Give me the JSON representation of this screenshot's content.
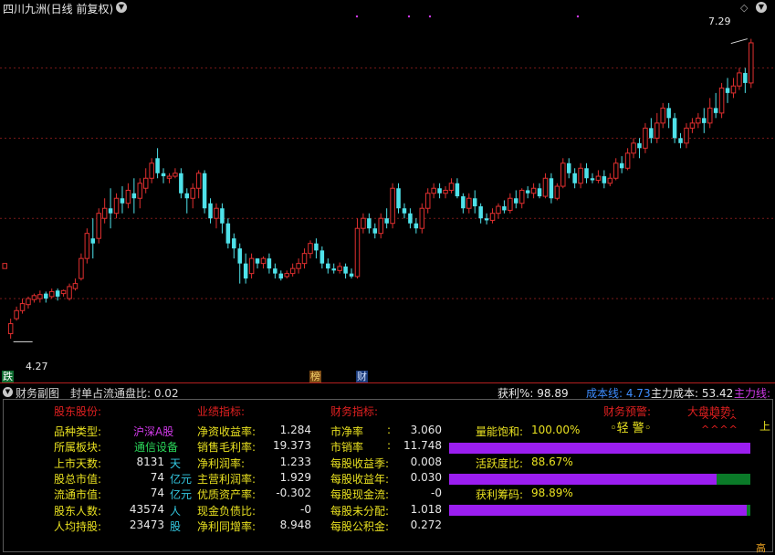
{
  "header": {
    "title": "四川九洲(日线 前复权)",
    "menu_icon": "chevron-down-icon",
    "right_icon": "diamond-icon",
    "high_label": "7.29",
    "low_label": "4.27"
  },
  "colors": {
    "up": "#e02f2f",
    "down": "#4fe2ea",
    "grid": "#7a1a1a",
    "accent_purple": "#9b1ef0",
    "bar_green": "#0a7a28"
  },
  "tags": {
    "die": "跌",
    "bang": "榜",
    "cai": "财"
  },
  "subchart": {
    "title": "财务副图",
    "seal_label": "封单占流通盘比: 0.02",
    "profit_label": "获利%: 98.89",
    "cost_line": "成本线: 4.73",
    "main_cost": "主力成本: 53.42",
    "main_line": "主力线:"
  },
  "panel": {
    "shareholder_header": "股东股份:",
    "perf_header": "业绩指标:",
    "fin_header": "财务指标:",
    "warn_header": "财务预警:",
    "trend_header": "大盘趋势:",
    "warn_value": "◦轻 警◦",
    "trend_value": "^^^^\n^^^^",
    "edge_text": "上",
    "edge_text2": "高",
    "col1": [
      {
        "label": "品种类型:",
        "value": "沪深A股",
        "unit": ""
      },
      {
        "label": "所属板块:",
        "value": "通信设备",
        "unit": ""
      },
      {
        "label": "上市天数:",
        "value": "8131",
        "unit": "天"
      },
      {
        "label": "股总市值:",
        "value": "74",
        "unit": "亿元"
      },
      {
        "label": "流通市值:",
        "value": "74",
        "unit": "亿元"
      },
      {
        "label": "股东人数:",
        "value": "43574",
        "unit": "人"
      },
      {
        "label": "人均持股:",
        "value": "23473",
        "unit": "股"
      }
    ],
    "col2": [
      {
        "label": "净资收益率:",
        "value": "1.284"
      },
      {
        "label": "销售毛利率:",
        "value": "19.373"
      },
      {
        "label": "净利润率:",
        "value": "1.233"
      },
      {
        "label": "主营利润率:",
        "value": "1.929"
      },
      {
        "label": "优质资产率:",
        "value": "-0.302"
      },
      {
        "label": "现金负债比:",
        "value": "-0"
      },
      {
        "label": "净利同增率:",
        "value": "8.948"
      }
    ],
    "col3": [
      {
        "label": "市净率",
        "sep": ":",
        "value": "3.060"
      },
      {
        "label": "市销率",
        "sep": ":",
        "value": "11.748"
      },
      {
        "label": "每股收益季:",
        "sep": "",
        "value": "0.008"
      },
      {
        "label": "每股收益年:",
        "sep": "",
        "value": "0.030"
      },
      {
        "label": "每股现金流:",
        "sep": "",
        "value": "-0"
      },
      {
        "label": "每股未分配:",
        "sep": "",
        "value": "1.018"
      },
      {
        "label": "每股公积金:",
        "sep": "",
        "value": "0.272"
      }
    ],
    "metrics": [
      {
        "label": "量能饱和:",
        "text": "100.00%",
        "value": 1.0
      },
      {
        "label": "活跃度比:",
        "text": "88.67%",
        "value": 0.8867
      },
      {
        "label": "获利筹码:",
        "text": "98.89%",
        "value": 0.9889
      }
    ]
  },
  "chart_data": {
    "type": "candlestick",
    "ylim": [
      4.0,
      7.55
    ],
    "grid_levels": [
      4.7,
      5.5,
      6.3,
      7.0
    ],
    "high_marker": 7.29,
    "low_marker": 4.27,
    "candles": [
      [
        5.0,
        5.05,
        5.05,
        5.05
      ],
      [
        4.35,
        4.45,
        4.3,
        4.5
      ],
      [
        4.5,
        4.58,
        4.48,
        4.62
      ],
      [
        4.58,
        4.65,
        4.55,
        4.7
      ],
      [
        4.64,
        4.7,
        4.6,
        4.72
      ],
      [
        4.69,
        4.73,
        4.66,
        4.75
      ],
      [
        4.7,
        4.74,
        4.66,
        4.78
      ],
      [
        4.75,
        4.7,
        4.66,
        4.77
      ],
      [
        4.72,
        4.77,
        4.7,
        4.8
      ],
      [
        4.78,
        4.72,
        4.68,
        4.8
      ],
      [
        4.75,
        4.78,
        4.72,
        4.79
      ],
      [
        4.7,
        4.82,
        4.68,
        4.85
      ],
      [
        4.8,
        4.85,
        4.78,
        4.9
      ],
      [
        4.9,
        5.1,
        4.88,
        5.15
      ],
      [
        5.1,
        5.35,
        5.05,
        5.4
      ],
      [
        5.3,
        5.25,
        5.1,
        5.5
      ],
      [
        5.3,
        5.55,
        5.25,
        5.6
      ],
      [
        5.5,
        5.6,
        5.45,
        5.7
      ],
      [
        5.6,
        5.55,
        5.4,
        5.8
      ],
      [
        5.55,
        5.7,
        5.5,
        5.75
      ],
      [
        5.7,
        5.65,
        5.55,
        5.82
      ],
      [
        5.65,
        5.78,
        5.6,
        5.85
      ],
      [
        5.75,
        5.7,
        5.55,
        5.9
      ],
      [
        5.7,
        5.85,
        5.6,
        5.9
      ],
      [
        5.8,
        5.9,
        5.75,
        6.0
      ],
      [
        5.9,
        6.05,
        5.85,
        6.1
      ],
      [
        6.1,
        5.95,
        5.9,
        6.2
      ],
      [
        5.95,
        5.92,
        5.85,
        6.0
      ],
      [
        5.9,
        5.92,
        5.85,
        5.95
      ],
      [
        5.92,
        5.95,
        5.9,
        6.0
      ],
      [
        5.95,
        5.75,
        5.7,
        6.0
      ],
      [
        5.75,
        5.7,
        5.55,
        5.8
      ],
      [
        5.7,
        5.8,
        5.6,
        5.85
      ],
      [
        5.8,
        5.95,
        5.7,
        5.98
      ],
      [
        5.95,
        5.6,
        5.55,
        5.98
      ],
      [
        5.65,
        5.5,
        5.45,
        5.7
      ],
      [
        5.5,
        5.6,
        5.4,
        5.65
      ],
      [
        5.6,
        5.45,
        5.35,
        5.65
      ],
      [
        5.45,
        5.25,
        5.2,
        5.5
      ],
      [
        5.3,
        5.2,
        5.1,
        5.35
      ],
      [
        5.2,
        5.05,
        4.85,
        5.25
      ],
      [
        5.05,
        4.9,
        4.85,
        5.15
      ],
      [
        4.95,
        5.1,
        4.9,
        5.15
      ],
      [
        5.1,
        5.05,
        5.0,
        5.1
      ],
      [
        5.05,
        5.1,
        5.0,
        5.12
      ],
      [
        5.1,
        5.0,
        4.95,
        5.15
      ],
      [
        5.0,
        4.95,
        4.9,
        5.05
      ],
      [
        4.95,
        4.9,
        4.88,
        4.98
      ],
      [
        4.92,
        4.95,
        4.9,
        4.98
      ],
      [
        4.95,
        5.0,
        4.92,
        5.05
      ],
      [
        5.0,
        5.05,
        4.95,
        5.1
      ],
      [
        5.05,
        5.15,
        5.0,
        5.2
      ],
      [
        5.15,
        5.25,
        5.1,
        5.28
      ],
      [
        5.25,
        5.18,
        5.1,
        5.3
      ],
      [
        5.18,
        5.05,
        5.0,
        5.22
      ],
      [
        5.05,
        5.0,
        4.95,
        5.1
      ],
      [
        5.0,
        4.98,
        4.95,
        5.05
      ],
      [
        4.98,
        5.02,
        4.95,
        5.06
      ],
      [
        5.02,
        4.95,
        4.9,
        5.05
      ],
      [
        4.95,
        4.92,
        4.9,
        5.0
      ],
      [
        4.92,
        5.4,
        4.9,
        5.5
      ],
      [
        5.4,
        5.5,
        5.35,
        5.55
      ],
      [
        5.5,
        5.4,
        5.35,
        5.55
      ],
      [
        5.4,
        5.35,
        5.3,
        5.45
      ],
      [
        5.35,
        5.5,
        5.3,
        5.55
      ],
      [
        5.5,
        5.45,
        5.4,
        5.6
      ],
      [
        5.45,
        5.8,
        5.4,
        5.85
      ],
      [
        5.8,
        5.6,
        5.55,
        5.85
      ],
      [
        5.6,
        5.55,
        5.5,
        5.65
      ],
      [
        5.55,
        5.45,
        5.4,
        5.6
      ],
      [
        5.45,
        5.4,
        5.35,
        5.5
      ],
      [
        5.4,
        5.6,
        5.35,
        5.65
      ],
      [
        5.6,
        5.75,
        5.55,
        5.8
      ],
      [
        5.75,
        5.8,
        5.7,
        5.85
      ],
      [
        5.8,
        5.75,
        5.7,
        5.85
      ],
      [
        5.75,
        5.78,
        5.7,
        5.82
      ],
      [
        5.78,
        5.85,
        5.75,
        5.9
      ],
      [
        5.85,
        5.72,
        5.7,
        5.9
      ],
      [
        5.72,
        5.6,
        5.55,
        5.75
      ],
      [
        5.6,
        5.7,
        5.55,
        5.75
      ],
      [
        5.7,
        5.62,
        5.55,
        5.78
      ],
      [
        5.62,
        5.5,
        5.45,
        5.65
      ],
      [
        5.5,
        5.48,
        5.44,
        5.55
      ],
      [
        5.48,
        5.55,
        5.45,
        5.6
      ],
      [
        5.55,
        5.62,
        5.5,
        5.65
      ],
      [
        5.62,
        5.58,
        5.55,
        5.68
      ],
      [
        5.58,
        5.7,
        5.55,
        5.75
      ],
      [
        5.7,
        5.65,
        5.6,
        5.78
      ],
      [
        5.65,
        5.78,
        5.6,
        5.8
      ],
      [
        5.78,
        5.75,
        5.7,
        5.82
      ],
      [
        5.75,
        5.8,
        5.7,
        5.85
      ],
      [
        5.8,
        5.72,
        5.7,
        5.85
      ],
      [
        5.72,
        5.9,
        5.7,
        5.95
      ],
      [
        5.9,
        5.7,
        5.65,
        5.95
      ],
      [
        5.7,
        5.82,
        5.68,
        5.85
      ],
      [
        5.82,
        6.05,
        5.8,
        6.1
      ],
      [
        6.05,
        5.95,
        5.9,
        6.1
      ],
      [
        5.95,
        5.85,
        5.8,
        6.0
      ],
      [
        5.85,
        6.0,
        5.8,
        6.05
      ],
      [
        6.0,
        5.9,
        5.85,
        6.05
      ],
      [
        5.9,
        5.88,
        5.85,
        5.95
      ],
      [
        5.88,
        5.92,
        5.85,
        5.98
      ],
      [
        5.92,
        5.85,
        5.8,
        5.98
      ],
      [
        5.85,
        5.9,
        5.82,
        5.95
      ],
      [
        5.9,
        6.05,
        5.88,
        6.1
      ],
      [
        6.05,
        6.0,
        5.95,
        6.12
      ],
      [
        6.0,
        6.15,
        5.98,
        6.2
      ],
      [
        6.15,
        6.25,
        6.1,
        6.3
      ],
      [
        6.25,
        6.2,
        6.1,
        6.3
      ],
      [
        6.2,
        6.4,
        6.15,
        6.45
      ],
      [
        6.4,
        6.3,
        6.25,
        6.5
      ],
      [
        6.3,
        6.45,
        6.25,
        6.55
      ],
      [
        6.45,
        6.6,
        6.4,
        6.65
      ],
      [
        6.6,
        6.5,
        6.4,
        6.65
      ],
      [
        6.5,
        6.3,
        6.25,
        6.55
      ],
      [
        6.3,
        6.25,
        6.2,
        6.35
      ],
      [
        6.25,
        6.4,
        6.2,
        6.45
      ],
      [
        6.4,
        6.45,
        6.35,
        6.5
      ],
      [
        6.45,
        6.5,
        6.4,
        6.55
      ],
      [
        6.5,
        6.45,
        6.35,
        6.6
      ],
      [
        6.45,
        6.6,
        6.4,
        6.7
      ],
      [
        6.6,
        6.55,
        6.5,
        6.75
      ],
      [
        6.55,
        6.8,
        6.5,
        6.85
      ],
      [
        6.8,
        6.75,
        6.65,
        6.9
      ],
      [
        6.75,
        6.82,
        6.7,
        6.9
      ],
      [
        6.82,
        6.95,
        6.78,
        7.0
      ],
      [
        6.95,
        6.85,
        6.75,
        7.0
      ],
      [
        6.85,
        7.25,
        6.8,
        7.29
      ]
    ]
  }
}
